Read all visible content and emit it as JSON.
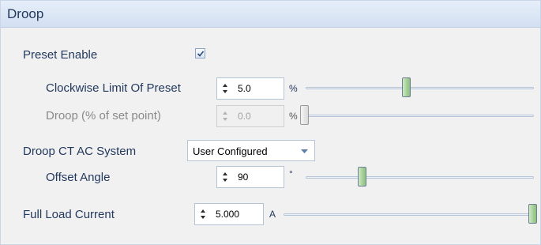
{
  "panel": {
    "title": "Droop"
  },
  "preset_enable": {
    "label": "Preset Enable",
    "checked": true
  },
  "clockwise_limit": {
    "label": "Clockwise Limit Of Preset",
    "value": "5.0",
    "unit": "%",
    "slider_fraction": 0.5
  },
  "droop_percent": {
    "label": "Droop (% of set point)",
    "value": "0.0",
    "unit": "%",
    "slider_fraction": 0.0,
    "disabled": true
  },
  "droop_ct": {
    "label": "Droop CT AC System",
    "selected": "User Configured"
  },
  "offset_angle": {
    "label": "Offset Angle",
    "value": "90",
    "unit": "°",
    "slider_fraction": 0.25
  },
  "full_load_current": {
    "label": "Full Load Current",
    "value": "5.000",
    "unit": "A",
    "slider_fraction": 1.0
  },
  "colors": {
    "header_bg": "#dce6f4",
    "label_text": "#23395d",
    "thumb_green": "#a9d39c"
  }
}
